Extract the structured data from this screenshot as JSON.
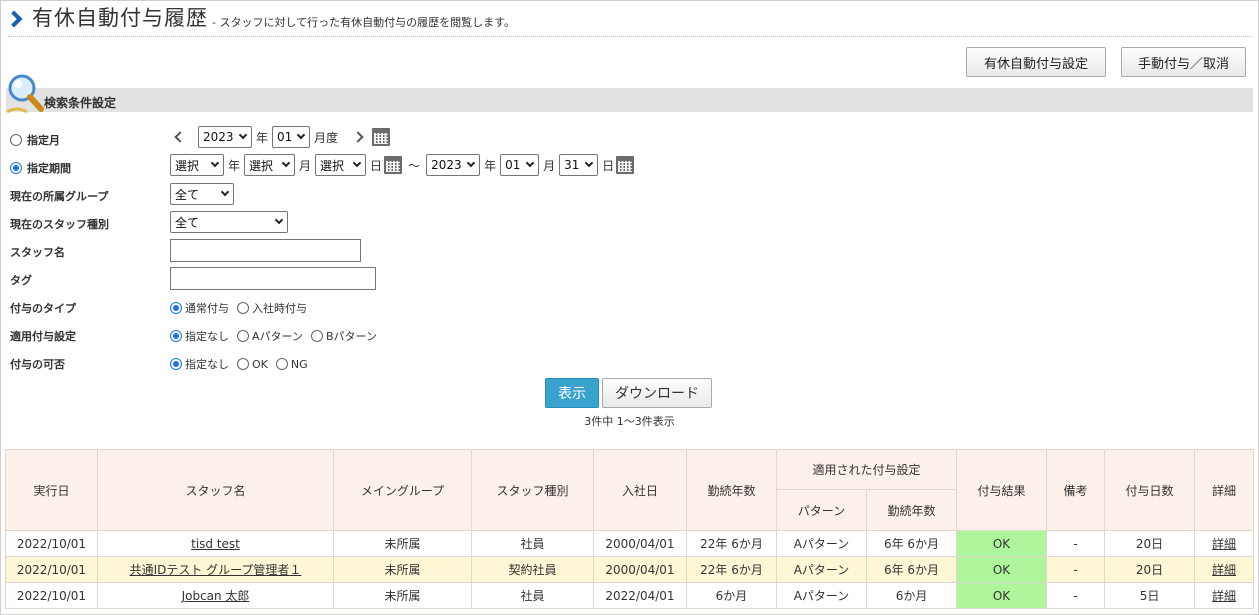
{
  "header": {
    "title": "有休自動付与履歴",
    "subtitle": "- スタッフに対して行った有休自動付与の履歴を閲覧します。"
  },
  "buttons": {
    "auto_settings": "有休自動付与設定",
    "manual": "手動付与／取消",
    "show": "表示",
    "download": "ダウンロード"
  },
  "search": {
    "section_title": "検索条件設定",
    "month": {
      "label": "指定月",
      "year": "2023",
      "year_unit": "年",
      "month": "01",
      "month_unit": "月度"
    },
    "period": {
      "label": "指定期間",
      "from_year": "選択",
      "from_month": "選択",
      "from_day": "選択",
      "tilde": "～",
      "to_year": "2023",
      "to_month": "01",
      "to_day": "31",
      "u_year": "年",
      "u_month": "月",
      "u_day": "日"
    },
    "group": {
      "label": "現在の所属グループ",
      "value": "全て"
    },
    "staff_type": {
      "label": "現在のスタッフ種別",
      "value": "全て"
    },
    "staff_name": {
      "label": "スタッフ名",
      "value": ""
    },
    "tag": {
      "label": "タグ",
      "value": ""
    },
    "grant_type": {
      "label": "付与のタイプ",
      "options": [
        "通常付与",
        "入社時付与"
      ],
      "selected": 0
    },
    "applied_setting": {
      "label": "適用付与設定",
      "options": [
        "指定なし",
        "Aパターン",
        "Bパターン"
      ],
      "selected": 0
    },
    "grant_result": {
      "label": "付与の可否",
      "options": [
        "指定なし",
        "OK",
        "NG"
      ],
      "selected": 0
    }
  },
  "result_count": "3件中 1～3件表示",
  "table": {
    "headers": {
      "date": "実行日",
      "staff": "スタッフ名",
      "group": "メイングループ",
      "type": "スタッフ種別",
      "joined": "入社日",
      "years": "勤続年数",
      "applied": "適用された付与設定",
      "pattern": "パターン",
      "applied_years": "勤続年数",
      "result": "付与結果",
      "note": "備考",
      "days": "付与日数",
      "detail": "詳細"
    },
    "rows": [
      {
        "date": "2022/10/01",
        "staff": "tisd test",
        "group": "未所属",
        "type": "社員",
        "joined": "2000/04/01",
        "years": "22年 6か月",
        "pattern": "Aパターン",
        "applied_years": "6年 6か月",
        "result": "OK",
        "note": "-",
        "days": "20日",
        "detail": "詳細"
      },
      {
        "date": "2022/10/01",
        "staff": "共通IDテスト グループ管理者１",
        "group": "未所属",
        "type": "契約社員",
        "joined": "2000/04/01",
        "years": "22年 6か月",
        "pattern": "Aパターン",
        "applied_years": "6年 6か月",
        "result": "OK",
        "note": "-",
        "days": "20日",
        "detail": "詳細"
      },
      {
        "date": "2022/10/01",
        "staff": "Jobcan 太郎",
        "group": "未所属",
        "type": "社員",
        "joined": "2022/04/01",
        "years": "6か月",
        "pattern": "Aパターン",
        "applied_years": "6か月",
        "result": "OK",
        "note": "-",
        "days": "5日",
        "detail": "詳細"
      }
    ]
  }
}
